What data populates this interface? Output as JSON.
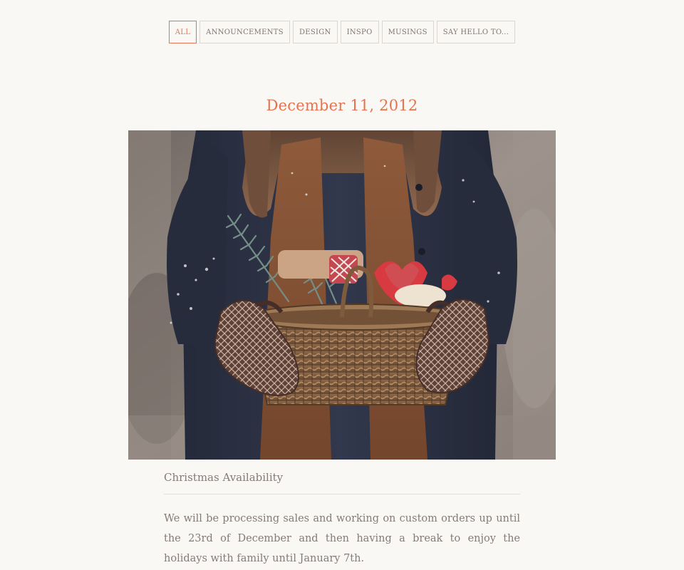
{
  "filters": [
    {
      "label": "ALL",
      "active": true
    },
    {
      "label": "ANNOUNCEMENTS",
      "active": false
    },
    {
      "label": "DESIGN",
      "active": false
    },
    {
      "label": "INSPO",
      "active": false
    },
    {
      "label": "MUSINGS",
      "active": false
    },
    {
      "label": "SAY HELLO TO...",
      "active": false
    }
  ],
  "post": {
    "date": "December 11, 2012",
    "title": "Christmas Availability",
    "body": "We will be processing sales and working on custom orders up until the 23rd of December and then having a break to enjoy the holidays with family until January 7th."
  },
  "colors": {
    "accent": "#e8724e",
    "background": "#faf8f5",
    "text": "#857a76"
  }
}
